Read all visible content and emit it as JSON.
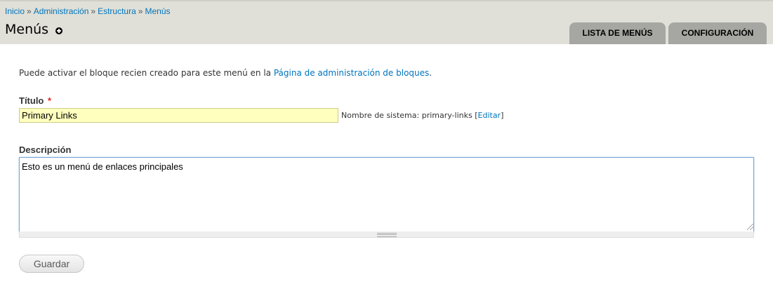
{
  "breadcrumb": {
    "items": [
      "Inicio",
      "Administración",
      "Estructura",
      "Menús"
    ],
    "separator": "»"
  },
  "page": {
    "title": "Menús",
    "shortcut_icon": "add-shortcut-icon"
  },
  "tabs": [
    {
      "label": "LISTA DE MENÚS",
      "active": false
    },
    {
      "label": "CONFIGURACIÓN",
      "active": false
    }
  ],
  "help": {
    "text_before": "Puede activar el bloque recien creado para este menú en la ",
    "link_text": "Página de administración de bloques",
    "text_after": "."
  },
  "form": {
    "title_label": "Título",
    "required_mark": "*",
    "title_value": "Primary Links",
    "machine_name_prefix": "Nombre de sistema: primary-links ",
    "machine_name_open": "[",
    "machine_name_edit": "Editar",
    "machine_name_close": "]",
    "description_label": "Descripción",
    "description_value": "Esto es un menú de enlaces principales",
    "save_label": "Guardar"
  },
  "colors": {
    "header_bg": "#e0e0d8",
    "tab_bg": "#a6a7a2",
    "link": "#0074bd",
    "required": "#e22222",
    "title_input_bg": "#ffffbe"
  }
}
